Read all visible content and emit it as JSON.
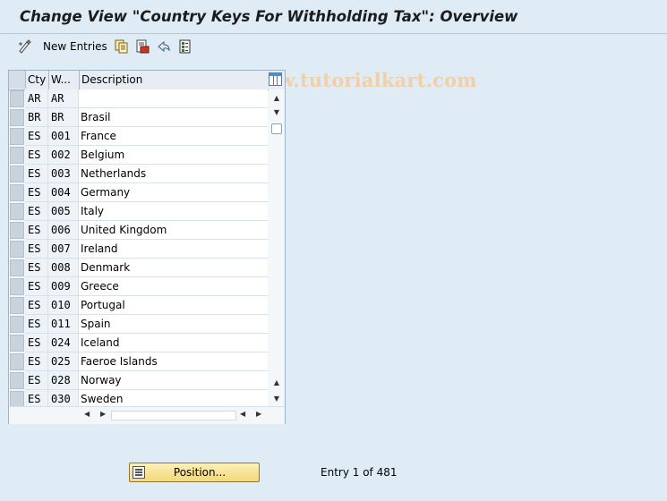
{
  "window": {
    "title": "Change View \"Country Keys For Withholding Tax\": Overview"
  },
  "toolbar": {
    "new_entries_label": "New Entries",
    "icons": [
      "edit-toggle-icon",
      "copy-icon",
      "delete-icon",
      "undo-icon",
      "select-all-icon"
    ]
  },
  "watermark": "© www.tutorialkart.com",
  "table": {
    "headers": {
      "cty": "Cty",
      "w": "W...",
      "description": "Description"
    },
    "rows": [
      {
        "cty": "AR",
        "w": "AR",
        "description": ""
      },
      {
        "cty": "BR",
        "w": "BR",
        "description": "Brasil"
      },
      {
        "cty": "ES",
        "w": "001",
        "description": "France"
      },
      {
        "cty": "ES",
        "w": "002",
        "description": "Belgium"
      },
      {
        "cty": "ES",
        "w": "003",
        "description": "Netherlands"
      },
      {
        "cty": "ES",
        "w": "004",
        "description": "Germany"
      },
      {
        "cty": "ES",
        "w": "005",
        "description": "Italy"
      },
      {
        "cty": "ES",
        "w": "006",
        "description": "United Kingdom"
      },
      {
        "cty": "ES",
        "w": "007",
        "description": "Ireland"
      },
      {
        "cty": "ES",
        "w": "008",
        "description": "Denmark"
      },
      {
        "cty": "ES",
        "w": "009",
        "description": "Greece"
      },
      {
        "cty": "ES",
        "w": "010",
        "description": "Portugal"
      },
      {
        "cty": "ES",
        "w": "011",
        "description": "Spain"
      },
      {
        "cty": "ES",
        "w": "024",
        "description": "Iceland"
      },
      {
        "cty": "ES",
        "w": "025",
        "description": "Faeroe Islands"
      },
      {
        "cty": "ES",
        "w": "028",
        "description": "Norway"
      },
      {
        "cty": "ES",
        "w": "030",
        "description": "Sweden"
      }
    ]
  },
  "footer": {
    "position_button_label": "Position...",
    "entry_text": "Entry 1 of 481"
  },
  "colors": {
    "background": "#dfebf5",
    "button_gold": "#f3d97a",
    "watermark": "#f1cfa9"
  }
}
